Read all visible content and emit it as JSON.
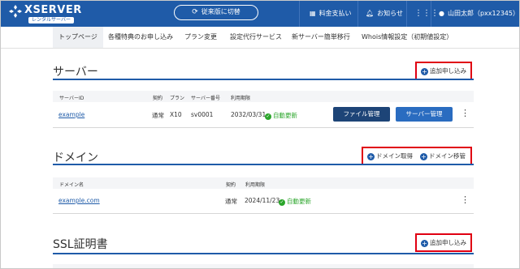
{
  "header": {
    "logo_text": "XSERVER",
    "logo_sub": "レンタルサーバー",
    "switch_label": "従来版に切替",
    "payment_label": "料金支払い",
    "notice_label": "お知らせ",
    "user_label": "山田太郎（pxx12345）",
    "brand_color": "#1f5ba8"
  },
  "nav": {
    "items": [
      "トップページ",
      "各種特典のお申し込み",
      "プラン変更",
      "設定代行サービス",
      "新サーバー簡単移行",
      "Whois情報設定（初期値設定）"
    ]
  },
  "server": {
    "title": "サーバー",
    "add_label": "追加申し込み",
    "columns": [
      "サーバーID",
      "契約",
      "プラン",
      "サーバー番号",
      "利用期限"
    ],
    "row": {
      "id": "example",
      "contract": "通常",
      "plan": "X10",
      "number": "sv0001",
      "expiry": "2032/03/31",
      "auto": "自動更新",
      "file_btn": "ファイル管理",
      "server_btn": "サーバー管理"
    }
  },
  "domain": {
    "title": "ドメイン",
    "get_label": "ドメイン取得",
    "transfer_label": "ドメイン移管",
    "columns": [
      "ドメイン名",
      "契約",
      "利用期限"
    ],
    "row": {
      "name": "example.com",
      "contract": "通常",
      "expiry": "2024/11/23",
      "auto": "自動更新"
    }
  },
  "ssl": {
    "title": "SSL証明書",
    "add_label": "追加申し込み"
  }
}
